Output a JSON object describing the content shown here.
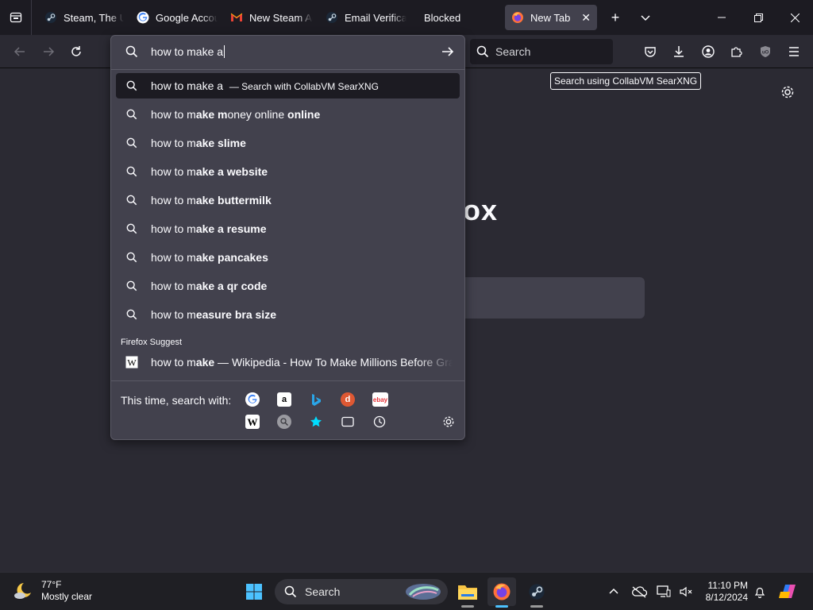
{
  "tabs": [
    {
      "title": "Steam, The Ul",
      "icon": "steam-icon"
    },
    {
      "title": "Google Accou",
      "icon": "google-icon"
    },
    {
      "title": "New Steam Ac",
      "icon": "gmail-icon"
    },
    {
      "title": "Email Verificat",
      "icon": "steam-icon"
    },
    {
      "title": "Blocked",
      "icon": ""
    },
    {
      "title": "New Tab",
      "icon": "firefox-icon",
      "active": true
    }
  ],
  "navbar": {
    "search_placeholder": "Search",
    "tooltip": "Search using CollabVM SearXNG"
  },
  "urlbar": {
    "value": "how to make a",
    "heuristic": {
      "query": "how to make a",
      "suffix": "— Search with CollabVM SearXNG"
    },
    "suggestions": [
      {
        "prefix": "how to m",
        "bold": "ake m",
        "rest": "oney online",
        "full": "how to make money online"
      },
      {
        "prefix": "how to m",
        "bold": "ake slime",
        "rest": "",
        "full": "how to make slime"
      },
      {
        "prefix": "how to m",
        "bold": "ake a website",
        "rest": "",
        "full": "how to make a website"
      },
      {
        "prefix": "how to m",
        "bold": "ake buttermilk",
        "rest": "",
        "full": "how to make buttermilk"
      },
      {
        "prefix": "how to m",
        "bold": "ake a resume",
        "rest": "",
        "full": "how to make a resume"
      },
      {
        "prefix": "how to m",
        "bold": "ake pancakes",
        "rest": "",
        "full": "how to make pancakes"
      },
      {
        "prefix": "how to m",
        "bold": "ake a qr code",
        "rest": "",
        "full": "how to make a qr code"
      },
      {
        "prefix": "how to m",
        "bold": "easure bra size",
        "rest": "",
        "full": "how to measure bra size"
      }
    ],
    "group_label": "Firefox Suggest",
    "wiki": {
      "prefix": "how to m",
      "bold": "ake",
      "rest": " — Wikipedia - How To Make Millions Before Gra"
    },
    "oneoff_label": "This time, search with:"
  },
  "newtab": {
    "logo_fragment": "ox"
  },
  "taskbar": {
    "temp": "77°F",
    "condition": "Mostly clear",
    "search_label": "Search",
    "time": "11:10 PM",
    "date": "8/12/2024"
  },
  "colors": {
    "accent": "#4cc2ff",
    "popup": "#42414d",
    "selected": "#1c1b22"
  }
}
